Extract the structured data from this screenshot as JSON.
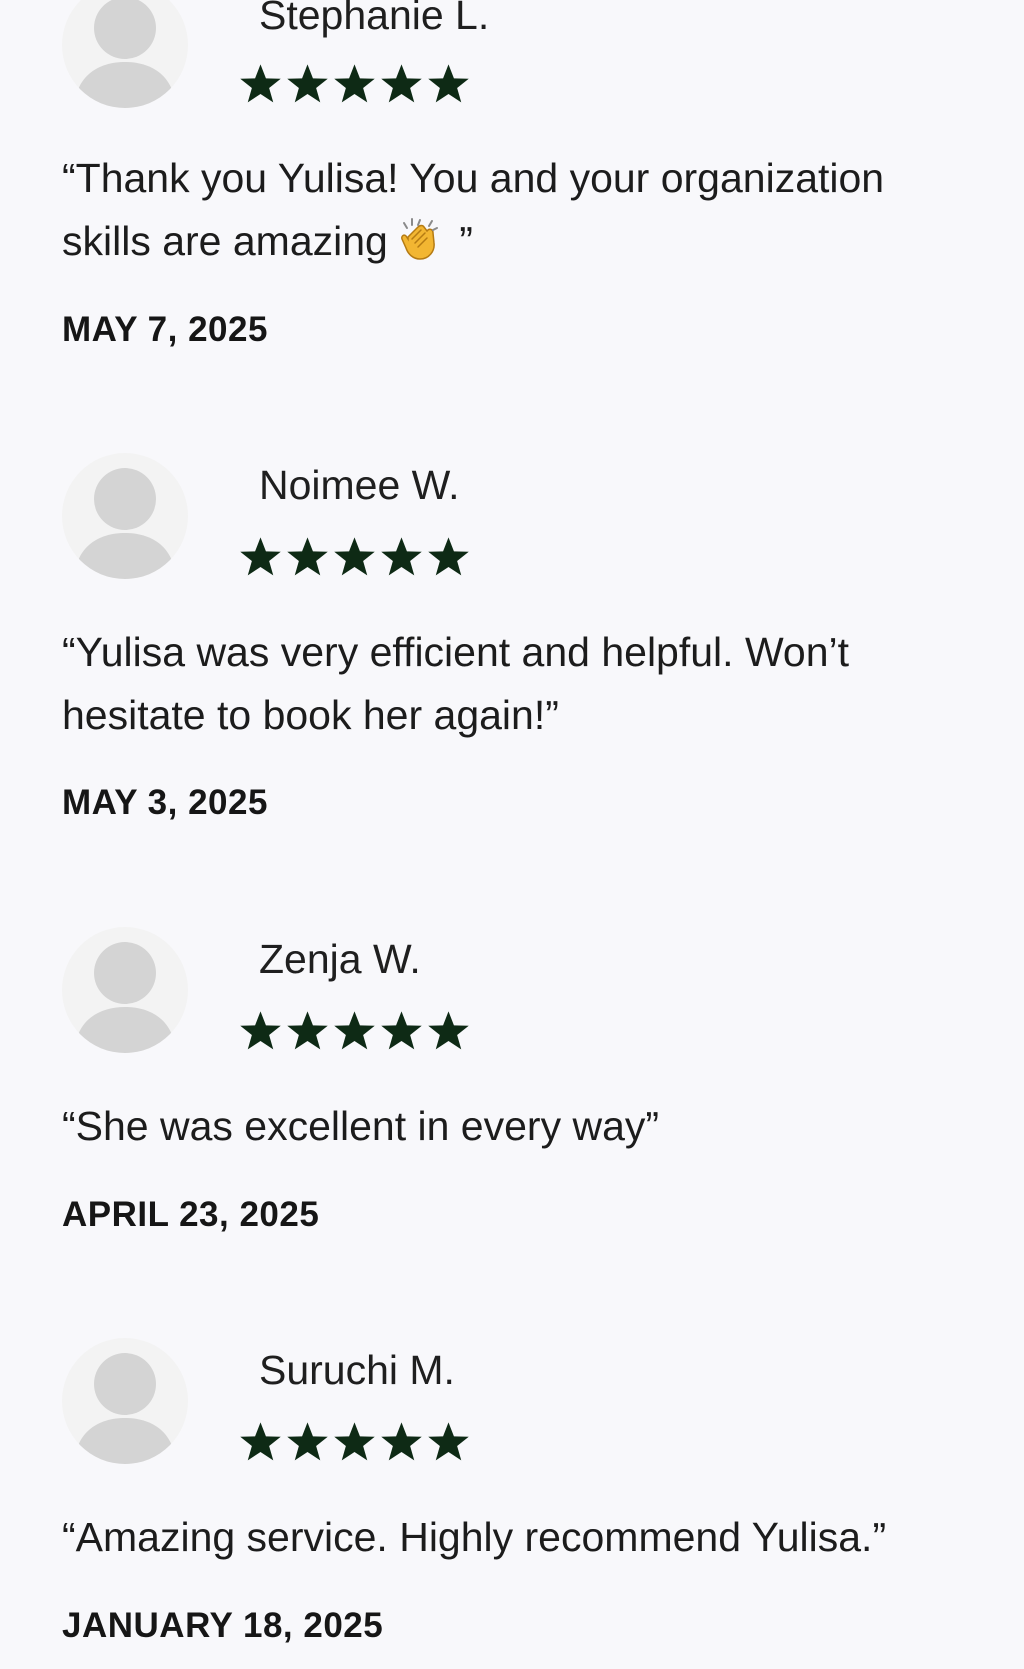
{
  "reviews": [
    {
      "name": "Stephanie L.",
      "rating": 5,
      "text": "“Thank you Yulisa! You and your organization skills are amazing",
      "emoji": "clapping-hands",
      "text_suffix": " ”",
      "date": "MAY 7, 2025"
    },
    {
      "name": "Noimee W.",
      "rating": 5,
      "text": "“Yulisa was very efficient and helpful. Won’t hesitate to book her again!”",
      "date": "MAY 3, 2025"
    },
    {
      "name": "Zenja W.",
      "rating": 5,
      "text": "“She was excellent in every way”",
      "date": "APRIL 23, 2025"
    },
    {
      "name": "Suruchi M.",
      "rating": 5,
      "text": "“Amazing service. Highly recommend Yulisa.”",
      "date": "JANUARY 18, 2025"
    }
  ],
  "colors": {
    "background": "#f8f8fb",
    "star": "#0e2a15",
    "avatar_figure": "#d4d4d4",
    "avatar_bg": "#f3f3f3"
  }
}
